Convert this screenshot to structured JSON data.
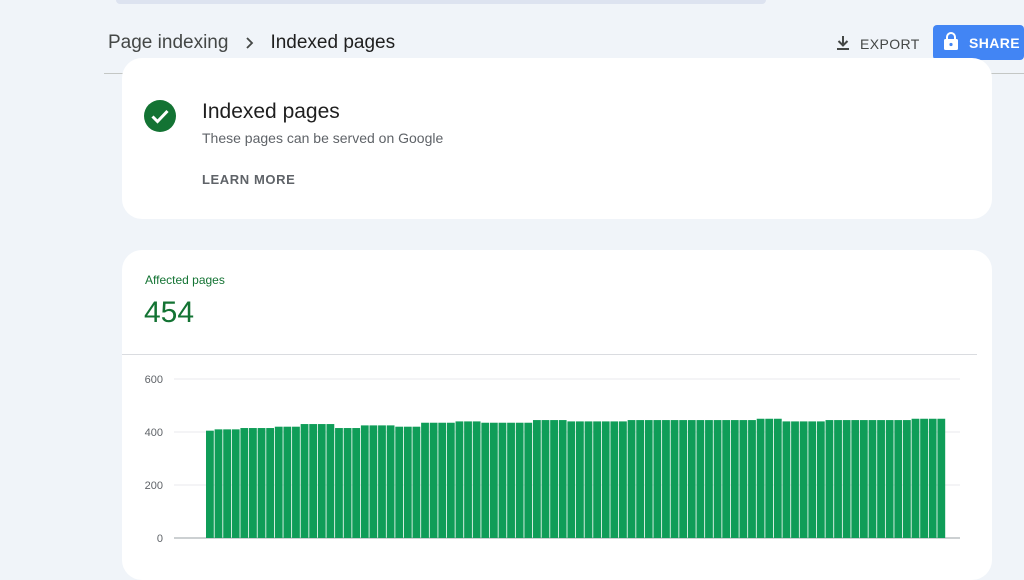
{
  "breadcrumb": {
    "parent": "Page indexing",
    "current": "Indexed pages"
  },
  "toolbar": {
    "export_label": "EXPORT",
    "share_label": "SHARE"
  },
  "info_card": {
    "title": "Indexed pages",
    "subtitle": "These pages can be served on Google",
    "learn_more": "LEARN MORE"
  },
  "summary": {
    "label": "Affected pages",
    "value": "454"
  },
  "colors": {
    "accent": "#4285f4",
    "success": "#137333",
    "bar": "#0f9d58"
  },
  "chart_data": {
    "type": "bar",
    "ylim": [
      0,
      600
    ],
    "yticks": [
      0,
      200,
      400,
      600
    ],
    "grid": true,
    "values": [
      405,
      410,
      410,
      410,
      415,
      415,
      415,
      415,
      420,
      420,
      420,
      430,
      430,
      430,
      430,
      415,
      415,
      415,
      425,
      425,
      425,
      425,
      420,
      420,
      420,
      435,
      435,
      435,
      435,
      440,
      440,
      440,
      435,
      435,
      435,
      435,
      435,
      435,
      445,
      445,
      445,
      445,
      440,
      440,
      440,
      440,
      440,
      440,
      440,
      445,
      445,
      445,
      445,
      445,
      445,
      445,
      445,
      445,
      445,
      445,
      445,
      445,
      445,
      445,
      450,
      450,
      450,
      440,
      440,
      440,
      440,
      440,
      445,
      445,
      445,
      445,
      445,
      445,
      445,
      445,
      445,
      445,
      450,
      450,
      450,
      450
    ]
  }
}
